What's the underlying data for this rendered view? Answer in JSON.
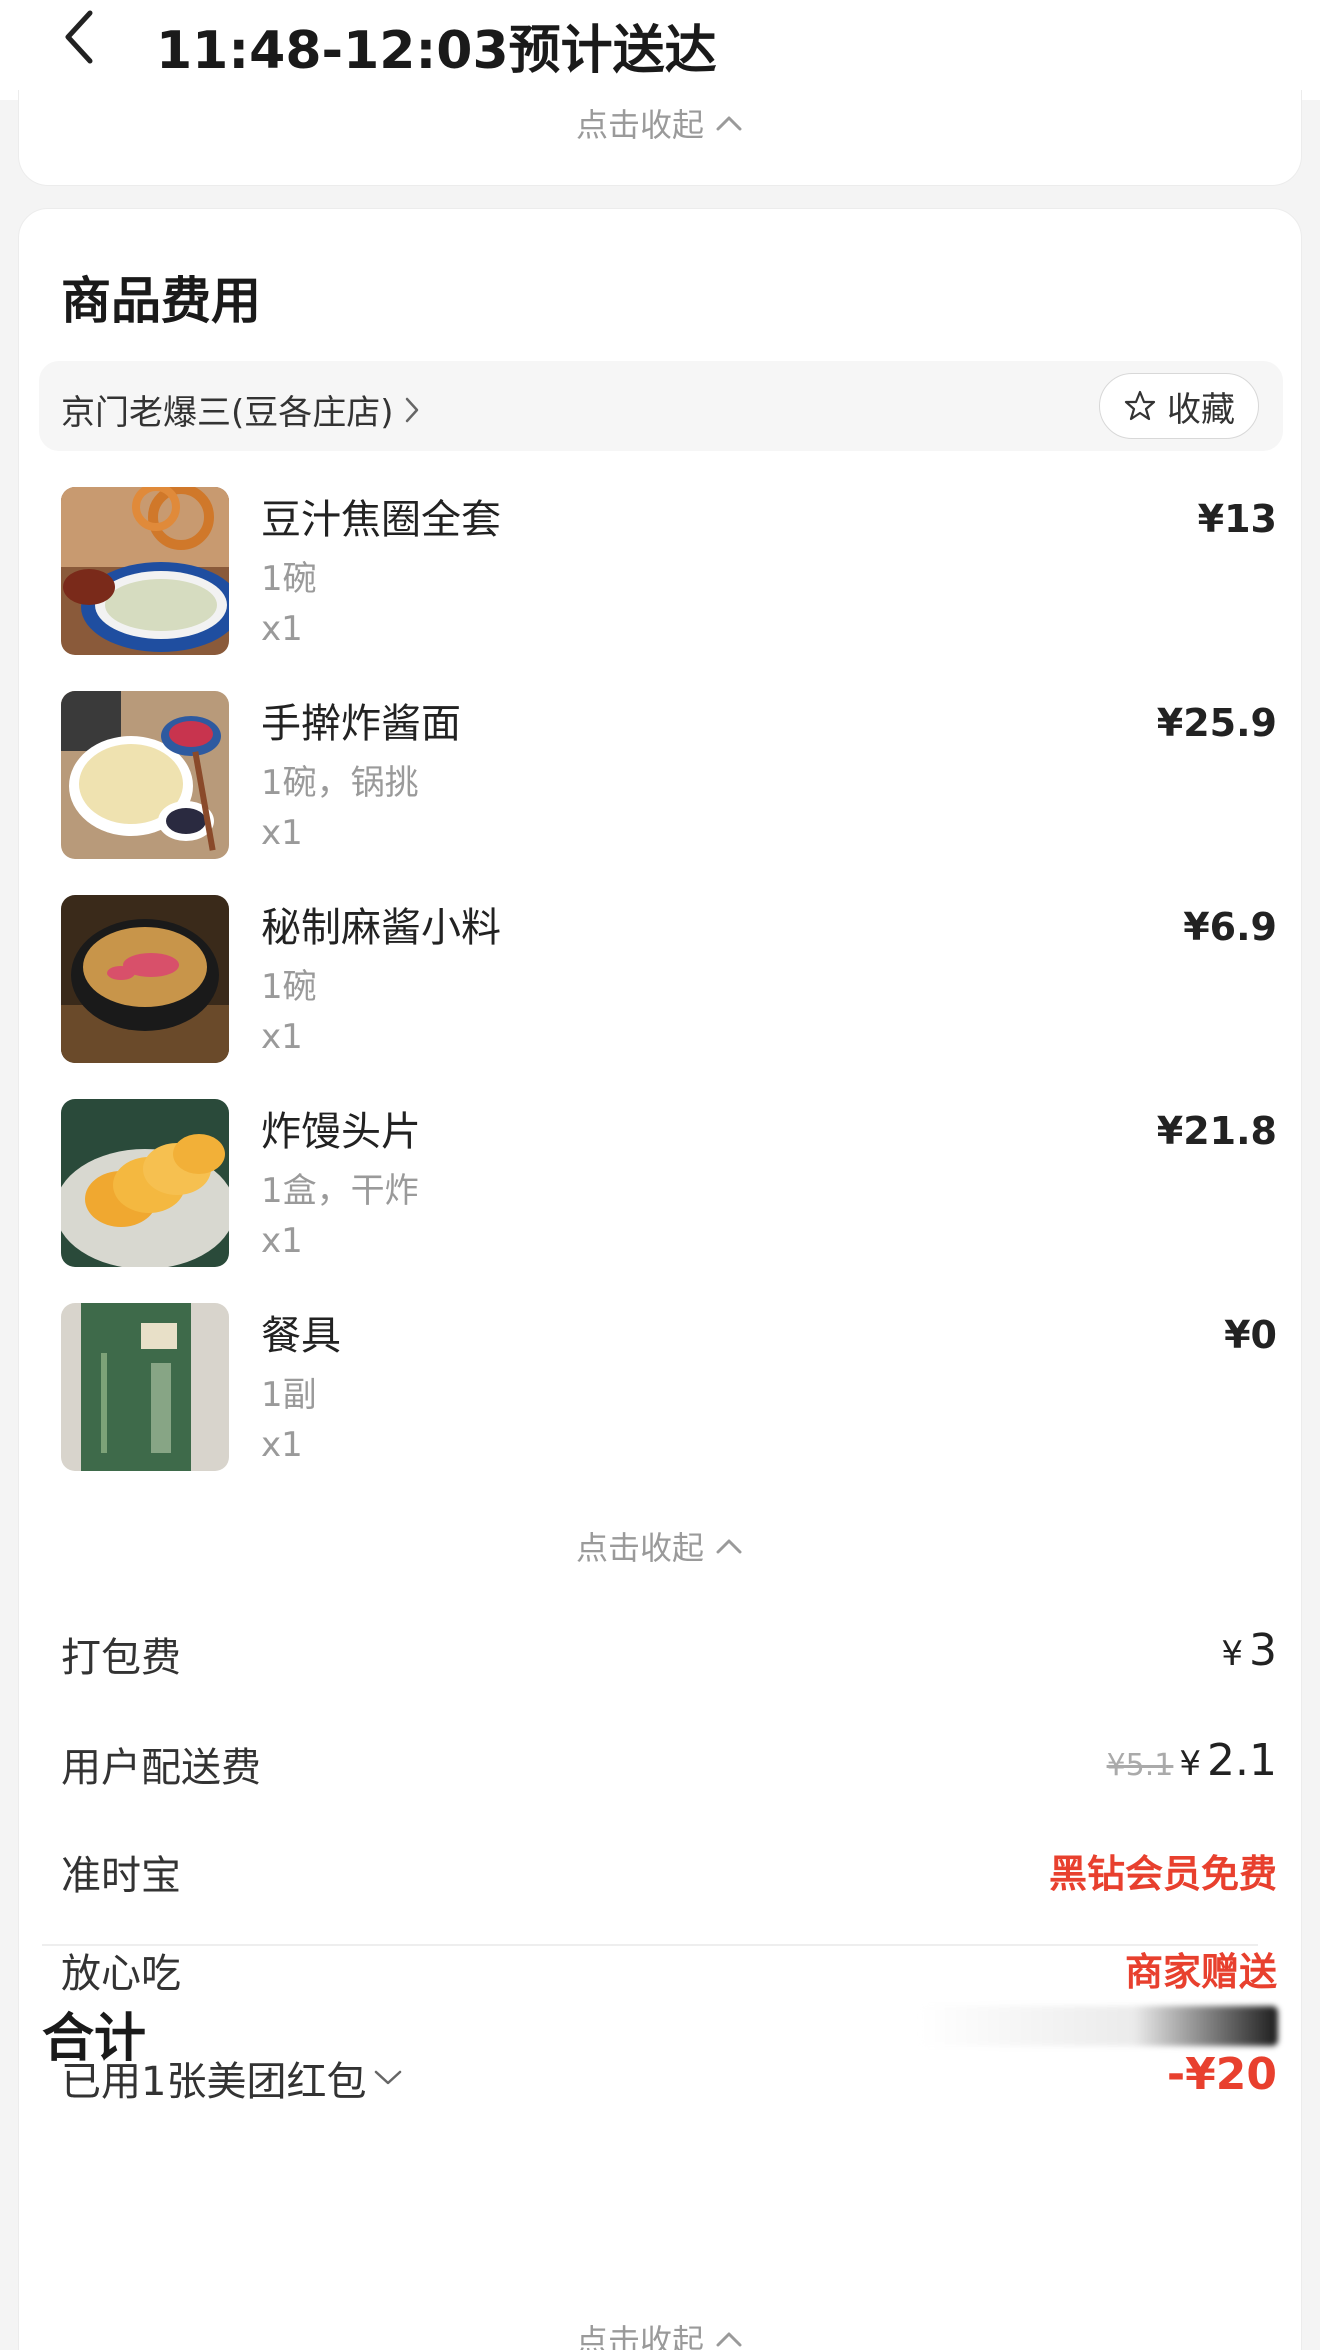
{
  "header": {
    "title": "11:48-12:03预计送达"
  },
  "top_card": {
    "collapse_label": "点击收起"
  },
  "fees_card": {
    "title": "商品费用",
    "shop": {
      "name": "京门老爆三(豆各庄店)",
      "favorite_label": "收藏"
    },
    "items": [
      {
        "name": "豆汁焦圈全套",
        "spec": "1碗",
        "qty": "x1",
        "price": "¥13"
      },
      {
        "name": "手擀炸酱面",
        "spec": "1碗，锅挑",
        "qty": "x1",
        "price": "¥25.9"
      },
      {
        "name": "秘制麻酱小料",
        "spec": "1碗",
        "qty": "x1",
        "price": "¥6.9"
      },
      {
        "name": "炸馒头片",
        "spec": "1盒，干炸",
        "qty": "x1",
        "price": "¥21.8"
      },
      {
        "name": "餐具",
        "spec": "1副",
        "qty": "x1",
        "price": "¥0"
      }
    ],
    "collapse_label": "点击收起",
    "fees": {
      "packing": {
        "label": "打包费",
        "yen": "¥",
        "value": "3"
      },
      "delivery": {
        "label": "用户配送费",
        "original": "¥5.1",
        "yen": "¥",
        "value": "2.1"
      },
      "ontime": {
        "label": "准时宝",
        "value": "黑钻会员免费"
      },
      "safe_eat": {
        "label": "放心吃",
        "value": "商家赠送"
      },
      "coupon": {
        "label": "已用1张美团红包",
        "value": "-¥20"
      }
    },
    "total_label": "合计",
    "bottom_collapse_label": "点击收起"
  },
  "colors": {
    "accent_red": "#e8402e",
    "background": "#f4f4f4",
    "card": "#ffffff"
  }
}
